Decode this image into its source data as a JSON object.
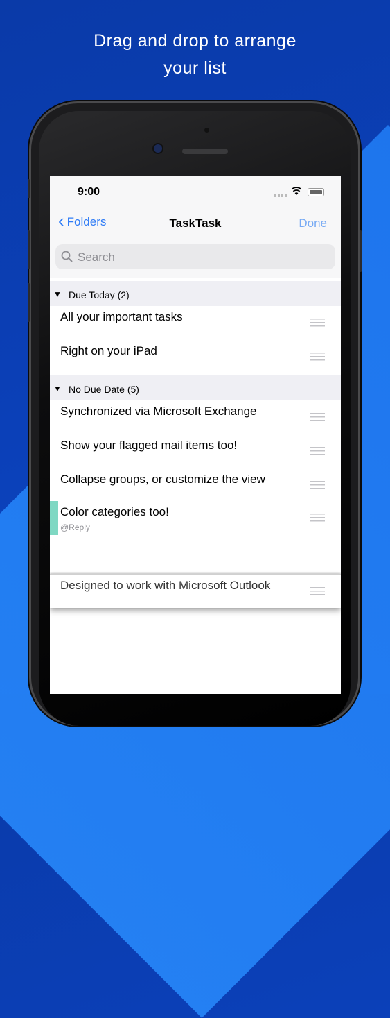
{
  "headline": {
    "line1": "Drag and drop to arrange",
    "line2": "your list"
  },
  "status": {
    "time": "9:00"
  },
  "nav": {
    "back_label": "Folders",
    "title": "TaskTask",
    "done_label": "Done"
  },
  "search": {
    "placeholder": "Search"
  },
  "sections": [
    {
      "label": "Due Today (2)",
      "items": [
        {
          "text": "All your important tasks"
        },
        {
          "text": "Right on your iPad"
        }
      ]
    },
    {
      "label": "No Due Date (5)",
      "items": [
        {
          "text": "Synchronized via Microsoft Exchange"
        },
        {
          "text": "Show your flagged mail items too!"
        },
        {
          "text": "Collapse groups, or customize the view"
        },
        {
          "text": "Color categories too!",
          "subtitle": "@Reply",
          "category_color": "#7fd8c3"
        }
      ]
    }
  ],
  "dragged_item": {
    "text": "Designed to work with Microsoft Outlook"
  },
  "colors": {
    "accent": "#2f7cf6",
    "background": "#0b3fb6"
  }
}
